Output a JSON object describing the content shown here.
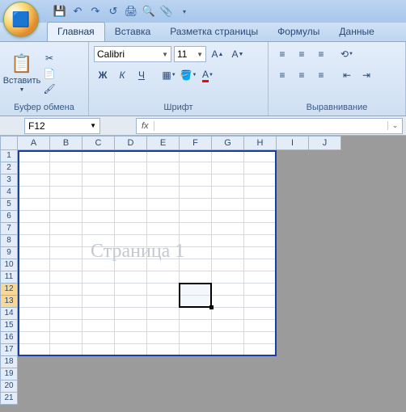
{
  "qat": {
    "icons": [
      "save",
      "undo",
      "redo",
      "undo2",
      "print",
      "preview",
      "attach"
    ]
  },
  "tabs": {
    "items": [
      "Главная",
      "Вставка",
      "Разметка страницы",
      "Формулы",
      "Данные"
    ],
    "active": 0
  },
  "ribbon": {
    "clipboard": {
      "paste": "Вставить",
      "label": "Буфер обмена"
    },
    "font": {
      "name": "Calibri",
      "size": "11",
      "label": "Шрифт",
      "btns": {
        "bold": "Ж",
        "italic": "К",
        "underline": "Ч"
      }
    },
    "align": {
      "label": "Выравнивание"
    }
  },
  "formula_bar": {
    "name_box": "F12",
    "fx": "fx",
    "value": ""
  },
  "grid": {
    "columns": [
      "A",
      "B",
      "C",
      "D",
      "E",
      "F",
      "G",
      "H",
      "I",
      "J"
    ],
    "row_count": 21,
    "selected_rows": [
      12,
      13
    ],
    "page_break": {
      "col_end": 8,
      "row_end": 17
    },
    "watermark": "Страница 1",
    "active_cell": {
      "col": 5,
      "row": 11
    }
  }
}
